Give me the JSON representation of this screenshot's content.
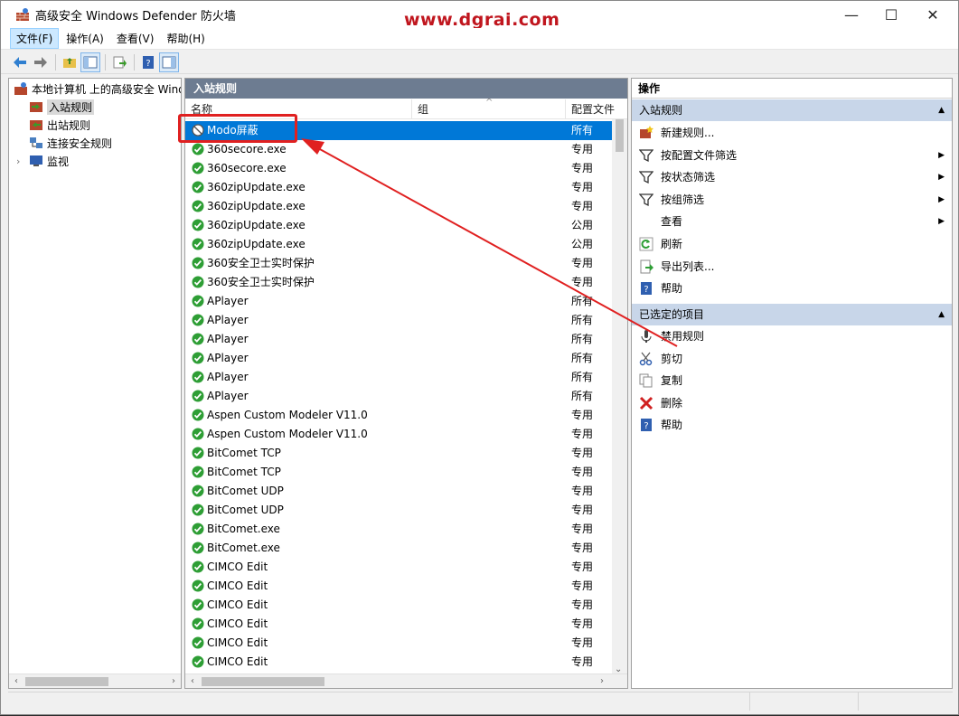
{
  "window": {
    "title": "高级安全 Windows Defender 防火墙",
    "watermark": "www.dgrai.com",
    "minimize": "—",
    "maximize": "☐",
    "close": "✕"
  },
  "menu": [
    "文件(F)",
    "操作(A)",
    "查看(V)",
    "帮助(H)"
  ],
  "tree": {
    "root": "本地计算机 上的高级安全 Windows",
    "items": [
      "入站规则",
      "出站规则",
      "连接安全规则",
      "监视"
    ]
  },
  "list": {
    "header": "入站规则",
    "columns": {
      "name": "名称",
      "group": "组",
      "profile": "配置文件"
    },
    "rows": [
      {
        "name": "Modo屏蔽",
        "profile": "所有",
        "status": "block"
      },
      {
        "name": "360secore.exe",
        "profile": "专用",
        "status": "allow"
      },
      {
        "name": "360secore.exe",
        "profile": "专用",
        "status": "allow"
      },
      {
        "name": "360zipUpdate.exe",
        "profile": "专用",
        "status": "allow"
      },
      {
        "name": "360zipUpdate.exe",
        "profile": "专用",
        "status": "allow"
      },
      {
        "name": "360zipUpdate.exe",
        "profile": "公用",
        "status": "allow"
      },
      {
        "name": "360zipUpdate.exe",
        "profile": "公用",
        "status": "allow"
      },
      {
        "name": "360安全卫士实时保护",
        "profile": "专用",
        "status": "allow"
      },
      {
        "name": "360安全卫士实时保护",
        "profile": "专用",
        "status": "allow"
      },
      {
        "name": "APlayer",
        "profile": "所有",
        "status": "allow"
      },
      {
        "name": "APlayer",
        "profile": "所有",
        "status": "allow"
      },
      {
        "name": "APlayer",
        "profile": "所有",
        "status": "allow"
      },
      {
        "name": "APlayer",
        "profile": "所有",
        "status": "allow"
      },
      {
        "name": "APlayer",
        "profile": "所有",
        "status": "allow"
      },
      {
        "name": "APlayer",
        "profile": "所有",
        "status": "allow"
      },
      {
        "name": "Aspen Custom Modeler V11.0",
        "profile": "专用",
        "status": "allow"
      },
      {
        "name": "Aspen Custom Modeler V11.0",
        "profile": "专用",
        "status": "allow"
      },
      {
        "name": "BitComet TCP",
        "profile": "专用",
        "status": "allow"
      },
      {
        "name": "BitComet TCP",
        "profile": "专用",
        "status": "allow"
      },
      {
        "name": "BitComet UDP",
        "profile": "专用",
        "status": "allow"
      },
      {
        "name": "BitComet UDP",
        "profile": "专用",
        "status": "allow"
      },
      {
        "name": "BitComet.exe",
        "profile": "专用",
        "status": "allow"
      },
      {
        "name": "BitComet.exe",
        "profile": "专用",
        "status": "allow"
      },
      {
        "name": "CIMCO Edit",
        "profile": "专用",
        "status": "allow"
      },
      {
        "name": "CIMCO Edit",
        "profile": "专用",
        "status": "allow"
      },
      {
        "name": "CIMCO Edit",
        "profile": "专用",
        "status": "allow"
      },
      {
        "name": "CIMCO Edit",
        "profile": "专用",
        "status": "allow"
      },
      {
        "name": "CIMCO Edit",
        "profile": "专用",
        "status": "allow"
      },
      {
        "name": "CIMCO Edit",
        "profile": "专用",
        "status": "allow"
      }
    ]
  },
  "actions": {
    "header": "操作",
    "section1": "入站规则",
    "section1_items": [
      "新建规则...",
      "按配置文件筛选",
      "按状态筛选",
      "按组筛选",
      "查看",
      "刷新",
      "导出列表...",
      "帮助"
    ],
    "section2": "已选定的项目",
    "section2_items": [
      "禁用规则",
      "剪切",
      "复制",
      "删除",
      "帮助"
    ]
  },
  "colors": {
    "selection": "#0078d7",
    "annotation": "#e02020",
    "panel_header": "#6d7c91",
    "section": "#c8d6e9"
  }
}
